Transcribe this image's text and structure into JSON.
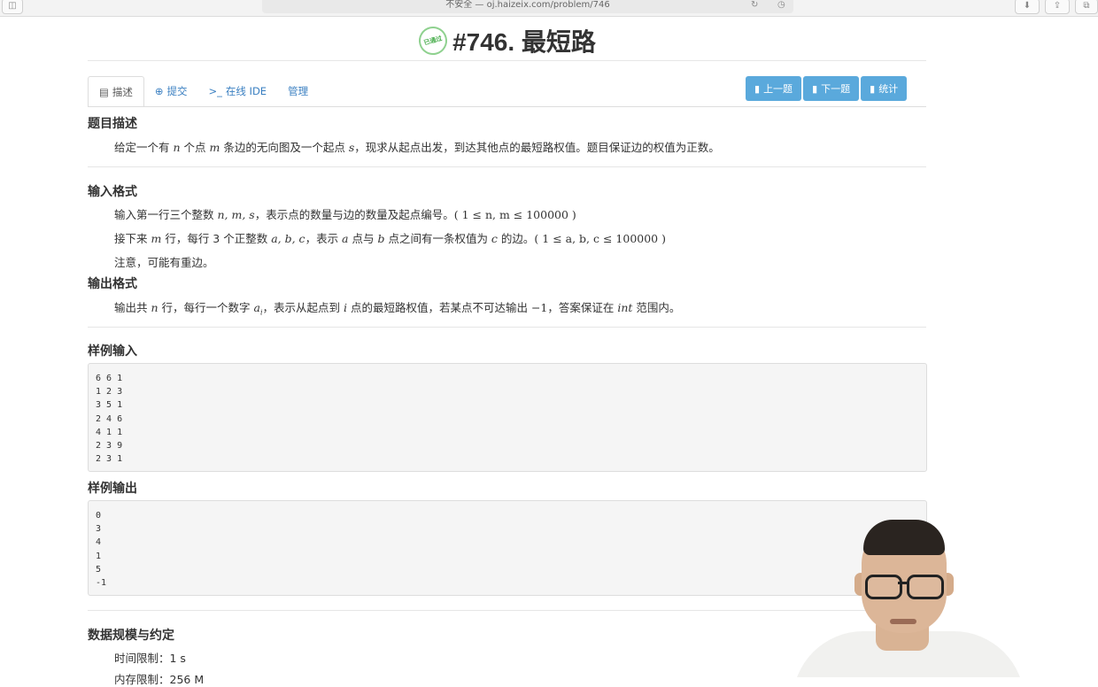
{
  "browser": {
    "address": "不安全 — oj.haizeix.com/problem/746",
    "reload_glyph": "↻",
    "history_glyph": "◷",
    "download_glyph": "⬇",
    "share_glyph": "⇪",
    "tabs_glyph": "⧉",
    "sidebar_glyph": "◫"
  },
  "problem": {
    "badge": "已通过",
    "title": "#746. 最短路"
  },
  "tabs": [
    {
      "icon": "▤",
      "label": "描述"
    },
    {
      "icon": "⊕",
      "label": "提交"
    },
    {
      "icon": ">_",
      "label": "在线 IDE"
    },
    {
      "icon": "",
      "label": "管理"
    }
  ],
  "nav_buttons": [
    {
      "icon": "▮",
      "label": "上一题"
    },
    {
      "icon": "▮",
      "label": "下一题"
    },
    {
      "icon": "▮",
      "label": "统计"
    }
  ],
  "description": {
    "heading": "题目描述",
    "text_1": "给定一个有 ",
    "n": "n",
    "text_2": " 个点 ",
    "m": "m",
    "text_3": " 条边的无向图及一个起点 ",
    "s": "s",
    "text_4": "，现求从起点出发，到达其他点的最短路权值。题目保证边的权值为正数。"
  },
  "input_format": {
    "heading": "输入格式",
    "line1_a": "输入第一行三个整数 ",
    "line1_vars": "n, m, s",
    "line1_b": "，表示点的数量与边的数量及起点编号。",
    "line1_range": "( 1 ≤ n, m ≤ 100000 )",
    "line2_a": "接下来 ",
    "line2_m": "m",
    "line2_b": " 行，每行 3 个正整数 ",
    "line2_vars": "a, b, c",
    "line2_c": "，表示 ",
    "line2_a2": "a",
    "line2_d": " 点与 ",
    "line2_b2": "b",
    "line2_e": " 点之间有一条权值为 ",
    "line2_c2": "c",
    "line2_f": " 的边。",
    "line2_range": "( 1 ≤ a, b, c ≤ 100000 )",
    "line3": "注意，可能有重边。"
  },
  "output_format": {
    "heading": "输出格式",
    "text_a": "输出共 ",
    "n": "n",
    "text_b": " 行，每行一个数字 ",
    "ai": "a",
    "sub": "i",
    "text_c": "，表示从起点到 ",
    "i": "i",
    "text_d": " 点的最短路权值，若某点不可达输出 ",
    "neg": "−1",
    "text_e": "，答案保证在 ",
    "int": "int",
    "text_f": " 范围内。"
  },
  "sample_input": {
    "heading": "样例输入",
    "content": "6 6 1\n1 2 3\n3 5 1\n2 4 6\n4 1 1\n2 3 9\n2 3 1"
  },
  "sample_output": {
    "heading": "样例输出",
    "content": "0\n3\n4\n1\n5\n-1"
  },
  "limits": {
    "heading": "数据规模与约定",
    "time": "时间限制：1 s",
    "memory": "内存限制：256 M"
  }
}
